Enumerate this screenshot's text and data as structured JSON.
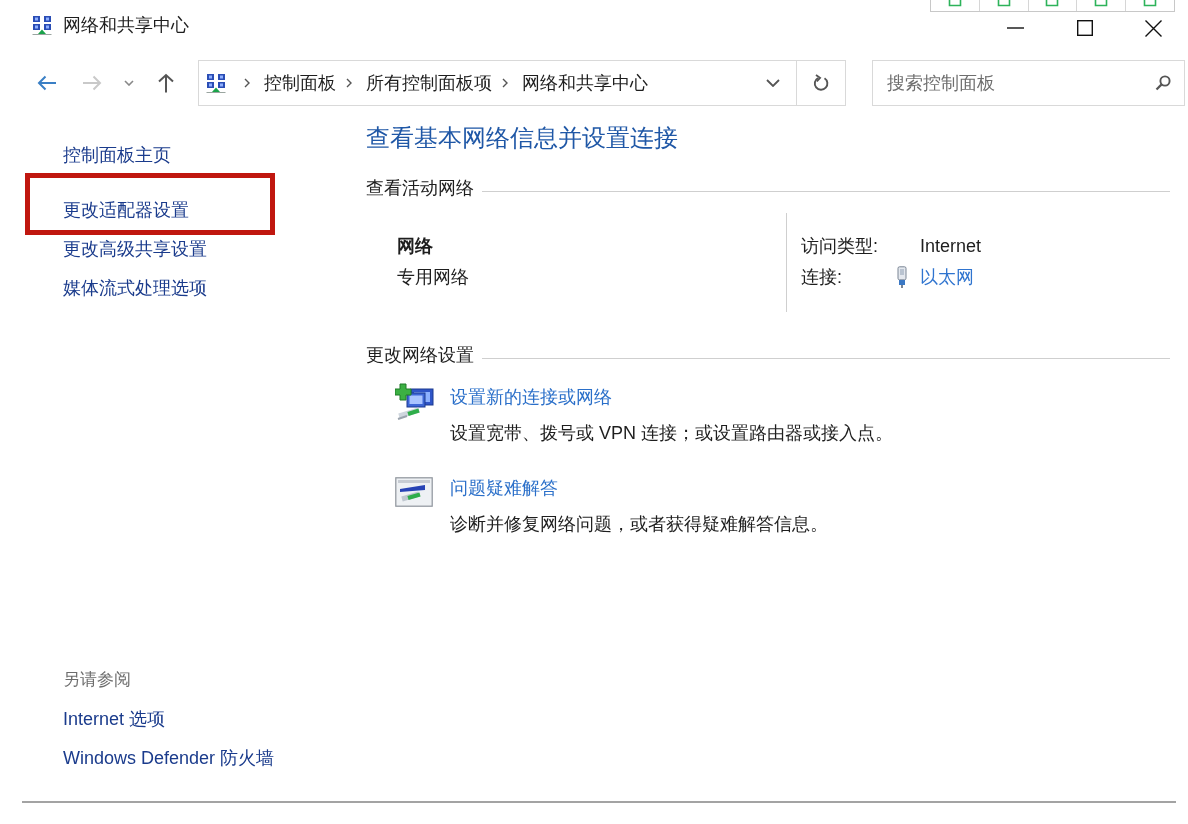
{
  "window": {
    "title": "网络和共享中心"
  },
  "address_bar": {
    "breadcrumbs": [
      "控制面板",
      "所有控制面板项",
      "网络和共享中心"
    ]
  },
  "search": {
    "placeholder": "搜索控制面板"
  },
  "sidebar": {
    "items": [
      {
        "label": "控制面板主页",
        "highlighted": false
      },
      {
        "label": "更改适配器设置",
        "highlighted": true
      },
      {
        "label": "更改高级共享设置",
        "highlighted": false
      },
      {
        "label": "媒体流式处理选项",
        "highlighted": false
      }
    ],
    "see_also": {
      "heading": "另请参阅",
      "links": [
        "Internet 选项",
        "Windows Defender 防火墙"
      ]
    }
  },
  "main": {
    "title": "查看基本网络信息并设置连接",
    "active_networks": {
      "heading": "查看活动网络",
      "network": {
        "name": "网络",
        "category": "专用网络"
      },
      "details": [
        {
          "kind": "text",
          "label": "访问类型:",
          "value": "Internet"
        },
        {
          "kind": "link",
          "label": "连接:",
          "value": "以太网"
        }
      ]
    },
    "change_settings": {
      "heading": "更改网络设置",
      "tasks": [
        {
          "kind": "new-connection",
          "link": "设置新的连接或网络",
          "description": "设置宽带、拨号或 VPN 连接；或设置路由器或接入点。"
        },
        {
          "kind": "troubleshoot",
          "link": "问题疑难解答",
          "description": "诊断并修复网络问题，或者获得疑难解答信息。"
        }
      ]
    }
  }
}
